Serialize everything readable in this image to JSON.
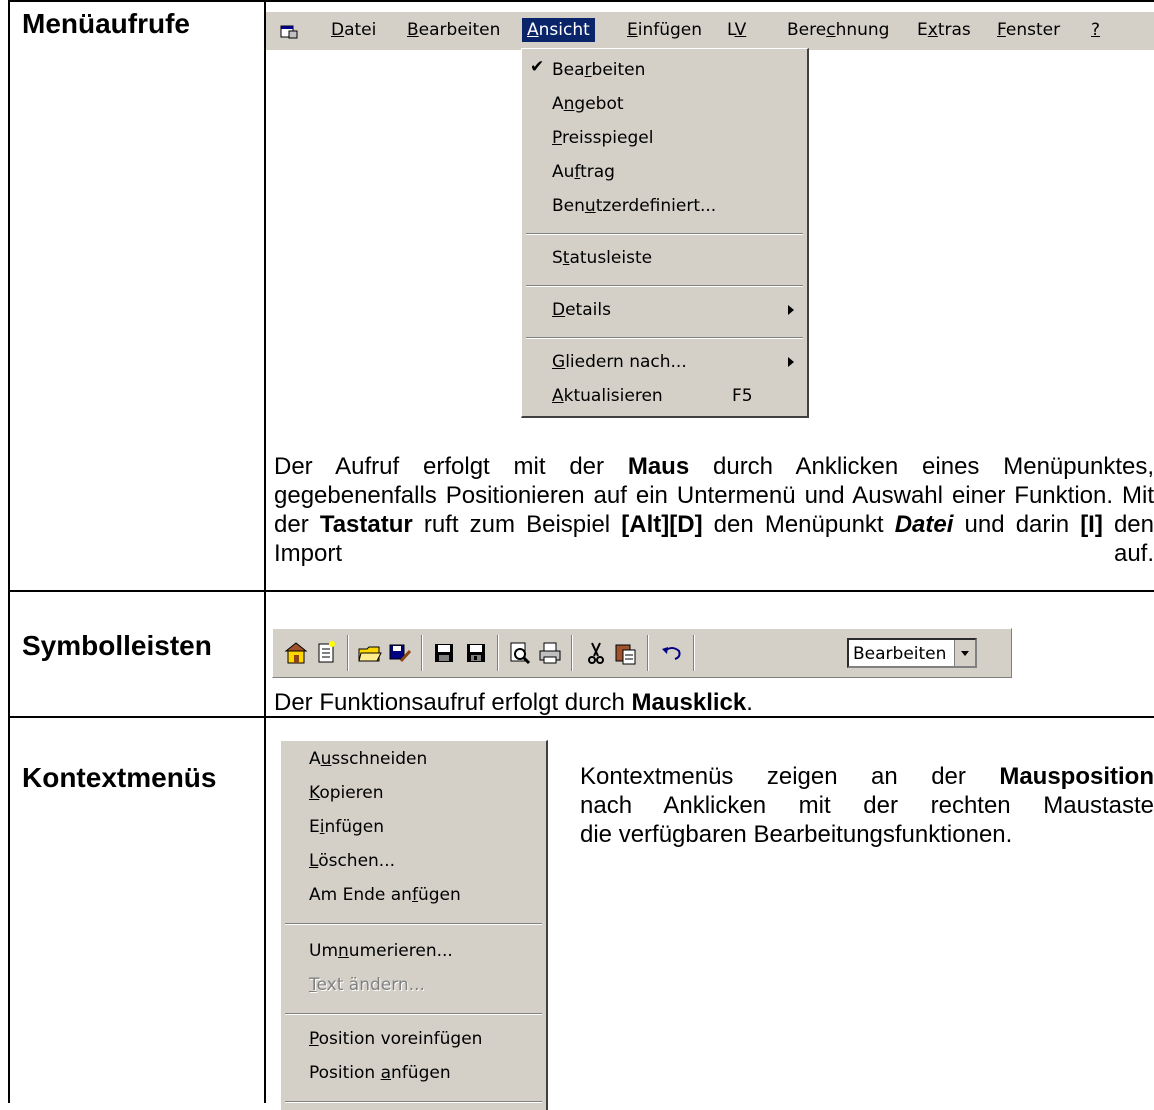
{
  "rows": {
    "menu_label": "Menüaufrufe",
    "toolbar_label": "Symbolleisten",
    "context_label": "Kontextmenüs"
  },
  "menubar": {
    "app_icon": "app-window-icon",
    "items": [
      "Datei",
      "Bearbeiten",
      "Ansicht",
      "Einfügen",
      "LV",
      "Berechnung",
      "Extras",
      "Fenster",
      "?"
    ],
    "active": "Ansicht"
  },
  "dropdown": {
    "items": {
      "bearbeiten": "Bearbeiten",
      "angebot": "Angebot",
      "preisspiegel": "Preisspiegel",
      "auftrag": "Auftrag",
      "benutzerdefiniert": "Benutzerdefiniert...",
      "statusleiste": "Statusleiste",
      "details": "Details",
      "gliedern": "Gliedern nach...",
      "aktualisieren": "Aktualisieren"
    },
    "shortcut_aktualisieren": "F5",
    "checked": "Bearbeiten"
  },
  "menu_text": {
    "p1": "Der Aufruf erfolgt mit der ",
    "b1": "Maus",
    "p2": " durch Anklicken eines Menüpunktes, gegebenenfalls Positionieren auf ein Untermenü und Auswahl einer Funktion. Mit der ",
    "b2": "Tastatur",
    "p3": " ruft zum Beispiel ",
    "b3": "[Alt][D]",
    "p4": " den Menüpunkt ",
    "b4": "Datei",
    "p5": " und darin ",
    "b5": "[I]",
    "p6": " den Import auf."
  },
  "toolbar": {
    "icons": [
      "new-project-icon",
      "new-document-icon",
      "open-folder-icon",
      "save-edit-icon",
      "save-icon",
      "save-all-icon",
      "print-preview-icon",
      "print-icon",
      "cut-icon",
      "paste-icon",
      "undo-icon"
    ],
    "combo_value": "Bearbeiten"
  },
  "toolbar_text": {
    "p1": "Der Funktionsaufruf erfolgt durch ",
    "b1": "Mausklick",
    "p2": "."
  },
  "context_menu": {
    "items": {
      "ausschneiden": "Ausschneiden",
      "kopieren": "Kopieren",
      "einfuegen": "Einfügen",
      "loeschen": "Löschen...",
      "am_ende": "Am Ende anfügen",
      "umnumerieren": "Umnumerieren...",
      "text_aendern": "Text ändern...",
      "position_vor": "Position voreinfügen",
      "position_an": "Position anfügen"
    },
    "disabled": "Text ändern..."
  },
  "context_text": {
    "line1_a": "Kontextmenüs zeigen an der ",
    "line1_b": "Mausposition",
    "line2": "nach Anklicken mit der rechten Maustaste",
    "line3": "die verfügbaren Bearbeitungsfunktionen."
  }
}
